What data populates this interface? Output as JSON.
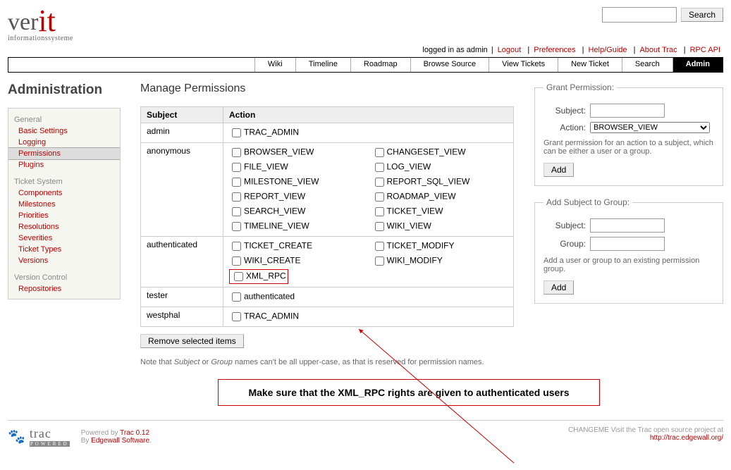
{
  "logo": {
    "a": "ver",
    "b": "it",
    "sub": "informationssysteme"
  },
  "search_btn": "Search",
  "meta": {
    "logged": "logged in as admin",
    "logout": "Logout",
    "prefs": "Preferences",
    "help": "Help/Guide",
    "about": "About Trac",
    "rpc": "RPC API"
  },
  "nav": [
    "Wiki",
    "Timeline",
    "Roadmap",
    "Browse Source",
    "View Tickets",
    "New Ticket",
    "Search",
    "Admin"
  ],
  "nav_active": "Admin",
  "h1": "Administration",
  "side": {
    "groups": [
      {
        "title": "General",
        "items": [
          "Basic Settings",
          "Logging",
          "Permissions",
          "Plugins"
        ],
        "sel": "Permissions"
      },
      {
        "title": "Ticket System",
        "items": [
          "Components",
          "Milestones",
          "Priorities",
          "Resolutions",
          "Severities",
          "Ticket Types",
          "Versions"
        ]
      },
      {
        "title": "Version Control",
        "items": [
          "Repositories"
        ]
      }
    ]
  },
  "h2": "Manage Permissions",
  "table": {
    "headers": [
      "Subject",
      "Action"
    ],
    "rows": [
      {
        "subject": "admin",
        "actions": [
          "TRAC_ADMIN"
        ]
      },
      {
        "subject": "anonymous",
        "actions": [
          "BROWSER_VIEW",
          "CHANGESET_VIEW",
          "FILE_VIEW",
          "LOG_VIEW",
          "MILESTONE_VIEW",
          "REPORT_SQL_VIEW",
          "REPORT_VIEW",
          "ROADMAP_VIEW",
          "SEARCH_VIEW",
          "TICKET_VIEW",
          "TIMELINE_VIEW",
          "WIKI_VIEW"
        ]
      },
      {
        "subject": "authenticated",
        "actions": [
          "TICKET_CREATE",
          "TICKET_MODIFY",
          "WIKI_CREATE",
          "WIKI_MODIFY",
          "XML_RPC"
        ],
        "highlight": "XML_RPC"
      },
      {
        "subject": "tester",
        "actions": [
          "authenticated"
        ]
      },
      {
        "subject": "westphal",
        "actions": [
          "TRAC_ADMIN"
        ]
      }
    ]
  },
  "remove_btn": "Remove selected items",
  "note_a": "Note that ",
  "note_b": "Subject",
  "note_c": " or ",
  "note_d": "Group",
  "note_e": " names can't be all upper-case, as that is reserved for permission names.",
  "grant": {
    "legend": "Grant Permission:",
    "subject_label": "Subject:",
    "action_label": "Action:",
    "action_value": "BROWSER_VIEW",
    "help": "Grant permission for an action to a subject, which can be either a user or a group.",
    "btn": "Add"
  },
  "group": {
    "legend": "Add Subject to Group:",
    "subject_label": "Subject:",
    "group_label": "Group:",
    "help": "Add a user or group to an existing permission group.",
    "btn": "Add"
  },
  "annotation": "Make sure that the XML_RPC rights are given to authenticated users",
  "footer": {
    "powered": "Powered by ",
    "trac": "Trac 0.12",
    "by": "By ",
    "edge": "Edgewall Software",
    "right1": "CHANGEME Visit the Trac open source project at",
    "right2": "http://trac.edgewall.org/"
  }
}
